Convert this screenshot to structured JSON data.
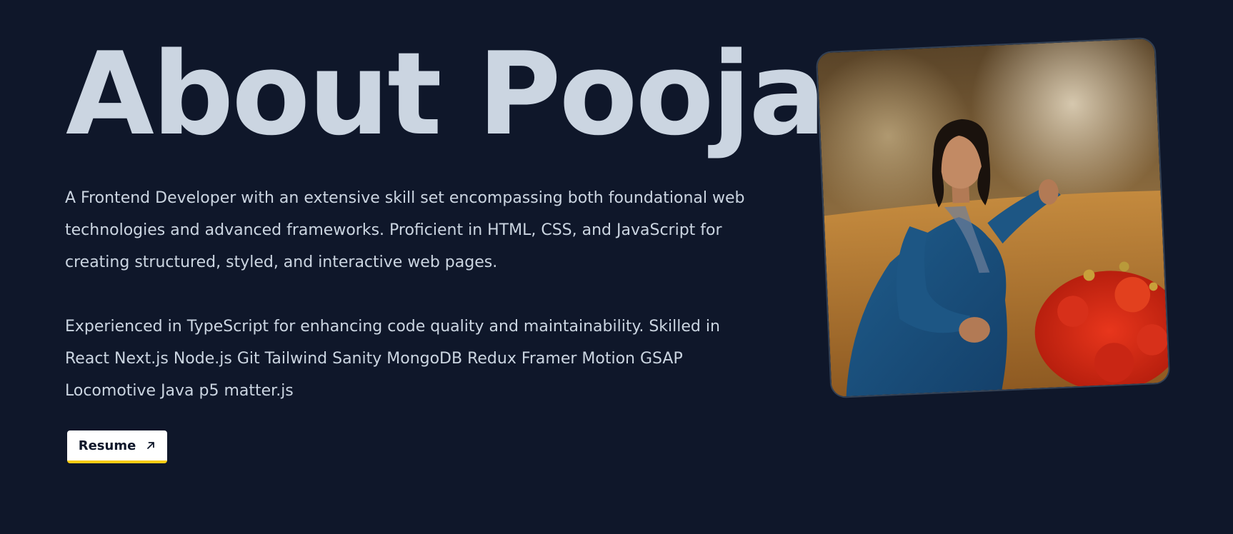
{
  "about": {
    "title": "About Pooja",
    "paragraph_1": "A Frontend Developer with an extensive skill set encompassing both foundational web technologies and advanced frameworks. Proficient in HTML, CSS, and JavaScript for creating structured, styled, and interactive web pages.",
    "paragraph_2": "Experienced in TypeScript for enhancing code quality and maintainability. Skilled in React Next.js Node.js Git Tailwind Sanity MongoDB Redux Framer Motion GSAP Locomotive Java p5 matter.js",
    "resume_label": "Resume",
    "resume_icon": "arrow-up-right-icon"
  },
  "colors": {
    "background": "#0f172a",
    "text": "#cbd5e1",
    "button_bg": "#ffffff",
    "button_accent": "#facc15"
  }
}
